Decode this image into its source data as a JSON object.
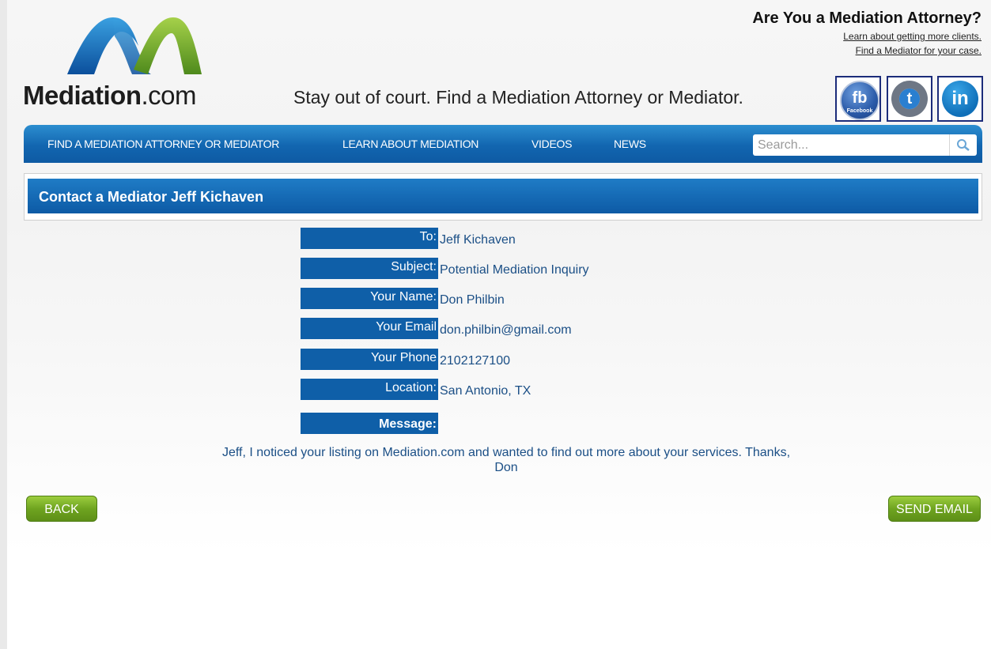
{
  "brand": {
    "name_bold": "Mediation",
    "name_suffix": ".com"
  },
  "tagline": "Stay out of court. Find a Mediation Attorney or Mediator.",
  "promo": {
    "title": "Are You a Mediation Attorney?",
    "links": [
      "Learn about getting more clients.",
      "Find a Mediator for your case."
    ]
  },
  "social": {
    "facebook": {
      "icon": "facebook-icon",
      "glyph": "fb",
      "caption": "Facebook"
    },
    "twitter": {
      "icon": "twitter-icon",
      "glyph": "t"
    },
    "linkedin": {
      "icon": "linkedin-icon",
      "glyph": "in"
    }
  },
  "nav": {
    "items": [
      "FIND A MEDIATION ATTORNEY OR MEDIATOR",
      "LEARN ABOUT MEDIATION",
      "VIDEOS",
      "NEWS"
    ],
    "search_placeholder": "Search..."
  },
  "page_title": "Contact a Mediator Jeff Kichaven",
  "form": {
    "fields": [
      {
        "label": "To:",
        "value": "Jeff Kichaven"
      },
      {
        "label": "Subject:",
        "value": "Potential Mediation Inquiry"
      },
      {
        "label": "Your Name:",
        "value": "Don Philbin"
      },
      {
        "label": "Your Email",
        "value": "don.philbin@gmail.com"
      },
      {
        "label": "Your Phone",
        "value": "2102127100"
      },
      {
        "label": "Location:",
        "value": "San Antonio, TX"
      }
    ],
    "message_label": "Message:",
    "message_line1": "Jeff, I noticed your listing on Mediation.com and wanted to find out more about your services. Thanks,",
    "message_line2": "Don"
  },
  "buttons": {
    "back": "BACK",
    "send": "SEND EMAIL"
  },
  "colors": {
    "nav_blue": "#1266b0",
    "label_blue": "#0f5fa8",
    "button_green": "#6fa420",
    "value_text": "#1b4f86"
  }
}
